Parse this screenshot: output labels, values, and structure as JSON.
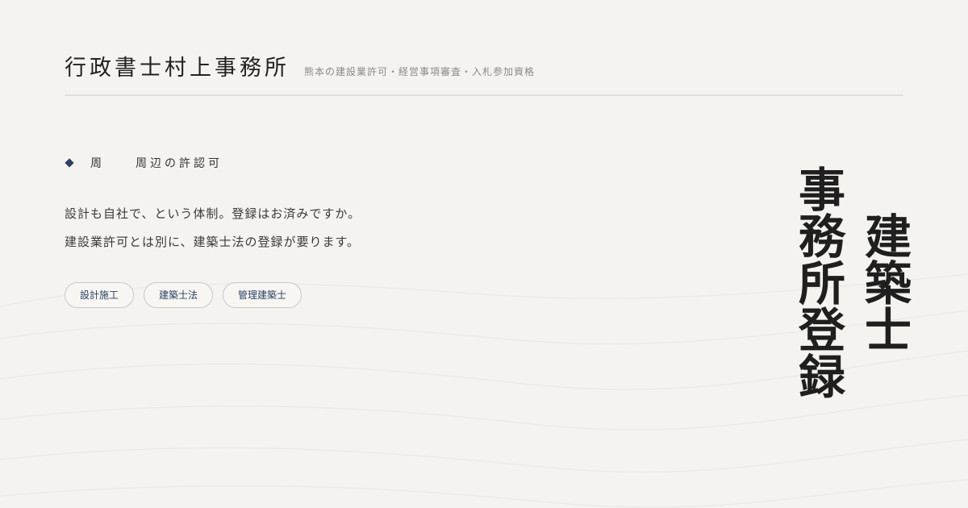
{
  "header": {
    "office_name": "行政書士村上事務所",
    "tagline": "熊本の建設業許可・経営事項審査・入札参加資格"
  },
  "section": {
    "icon": "diamond-icon",
    "label_short": "周",
    "label_full": "周辺の許認可"
  },
  "lead": {
    "line1": "設計も自社で、という体制。登録はお済みですか。",
    "line2": "建設業許可とは別に、建築士法の登録が要ります。"
  },
  "tags": [
    "設計施工",
    "建築士法",
    "管理建築士"
  ],
  "title": {
    "column1": "建築士",
    "column2": "事務所登録"
  },
  "colors": {
    "background": "#f4f3ef",
    "accent": "#2c4263",
    "text": "#2b2b2b"
  }
}
